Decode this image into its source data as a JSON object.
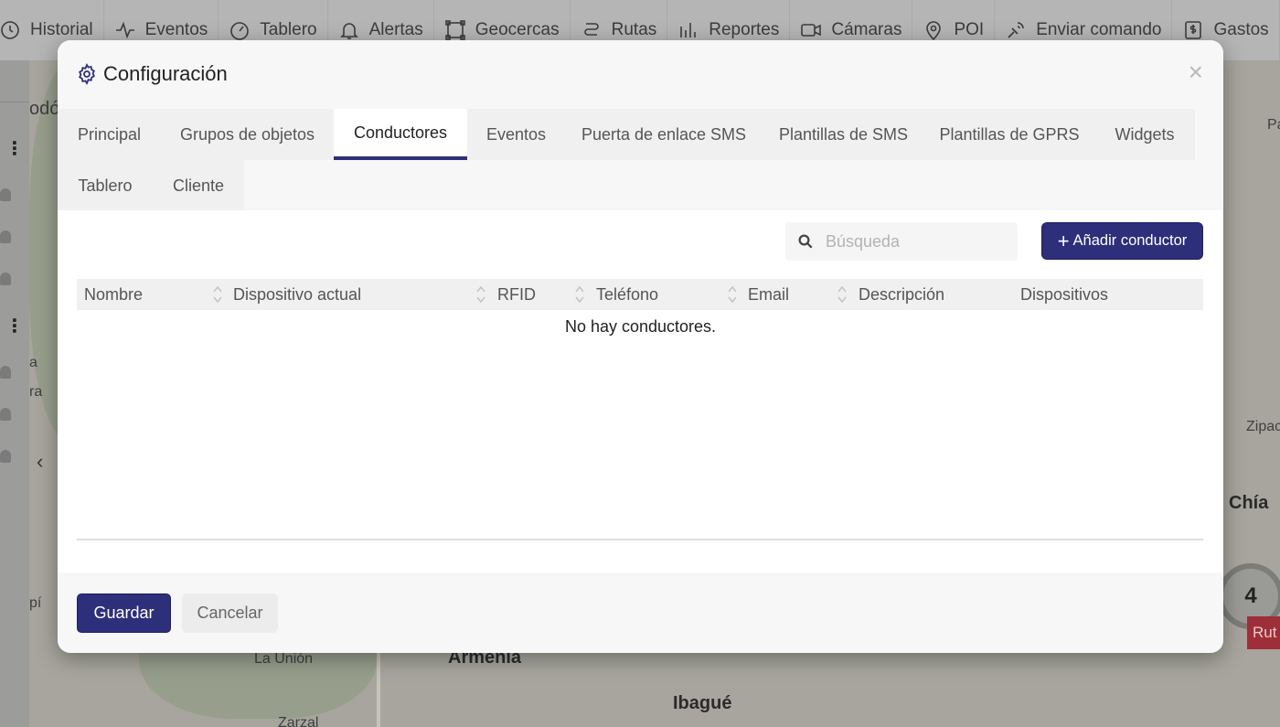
{
  "topnav": {
    "items": [
      {
        "label": "Historial",
        "icon": "history-icon"
      },
      {
        "label": "Eventos",
        "icon": "pulse-icon"
      },
      {
        "label": "Tablero",
        "icon": "gauge-icon"
      },
      {
        "label": "Alertas",
        "icon": "bell-icon"
      },
      {
        "label": "Geocercas",
        "icon": "polygon-icon"
      },
      {
        "label": "Rutas",
        "icon": "route-icon"
      },
      {
        "label": "Reportes",
        "icon": "bar-chart-icon"
      },
      {
        "label": "Cámaras",
        "icon": "camera-icon"
      },
      {
        "label": "POI",
        "icon": "map-pin-icon"
      },
      {
        "label": "Enviar comando",
        "icon": "satellite-icon"
      },
      {
        "label": "Gastos",
        "icon": "dollar-document-icon"
      }
    ]
  },
  "map": {
    "labels": {
      "armenia": "Armenia",
      "ibague": "Ibagué",
      "chia": "Chía",
      "la_union": "La Unión",
      "zipaquira": "Zipac",
      "zarzal": "Zarzal",
      "godoy": "odó",
      "pi": "pí",
      "a": "a",
      "ra": "ra",
      "pa": "Pa"
    },
    "cluster_count": "4",
    "route_tag": "Rut"
  },
  "modal": {
    "title": "Configuración",
    "close_symbol": "×",
    "tabs": [
      {
        "label": "Principal",
        "active": false
      },
      {
        "label": "Grupos de objetos",
        "active": false
      },
      {
        "label": "Conductores",
        "active": true
      },
      {
        "label": "Eventos",
        "active": false
      },
      {
        "label": "Puerta de enlace SMS",
        "active": false
      },
      {
        "label": "Plantillas de SMS",
        "active": false
      },
      {
        "label": "Plantillas de GPRS",
        "active": false
      },
      {
        "label": "Widgets",
        "active": false
      },
      {
        "label": "Tablero",
        "active": false
      },
      {
        "label": "Cliente",
        "active": false
      }
    ],
    "search": {
      "placeholder": "Búsqueda",
      "value": ""
    },
    "add_button": {
      "plus": "+",
      "label": "Añadir conductor"
    },
    "table": {
      "columns": [
        {
          "label": "Nombre",
          "sortable": true
        },
        {
          "label": "Dispositivo actual",
          "sortable": true
        },
        {
          "label": "RFID",
          "sortable": true
        },
        {
          "label": "Teléfono",
          "sortable": true
        },
        {
          "label": "Email",
          "sortable": true
        },
        {
          "label": "Descripción",
          "sortable": false
        },
        {
          "label": "Dispositivos",
          "sortable": false
        }
      ],
      "empty_message": "No hay conductores."
    },
    "footer": {
      "save_label": "Guardar",
      "cancel_label": "Cancelar"
    }
  },
  "colors": {
    "primary": "#2e2f7a",
    "tab_bg": "#f0f0f0",
    "header_bg": "#f7f7f7"
  }
}
